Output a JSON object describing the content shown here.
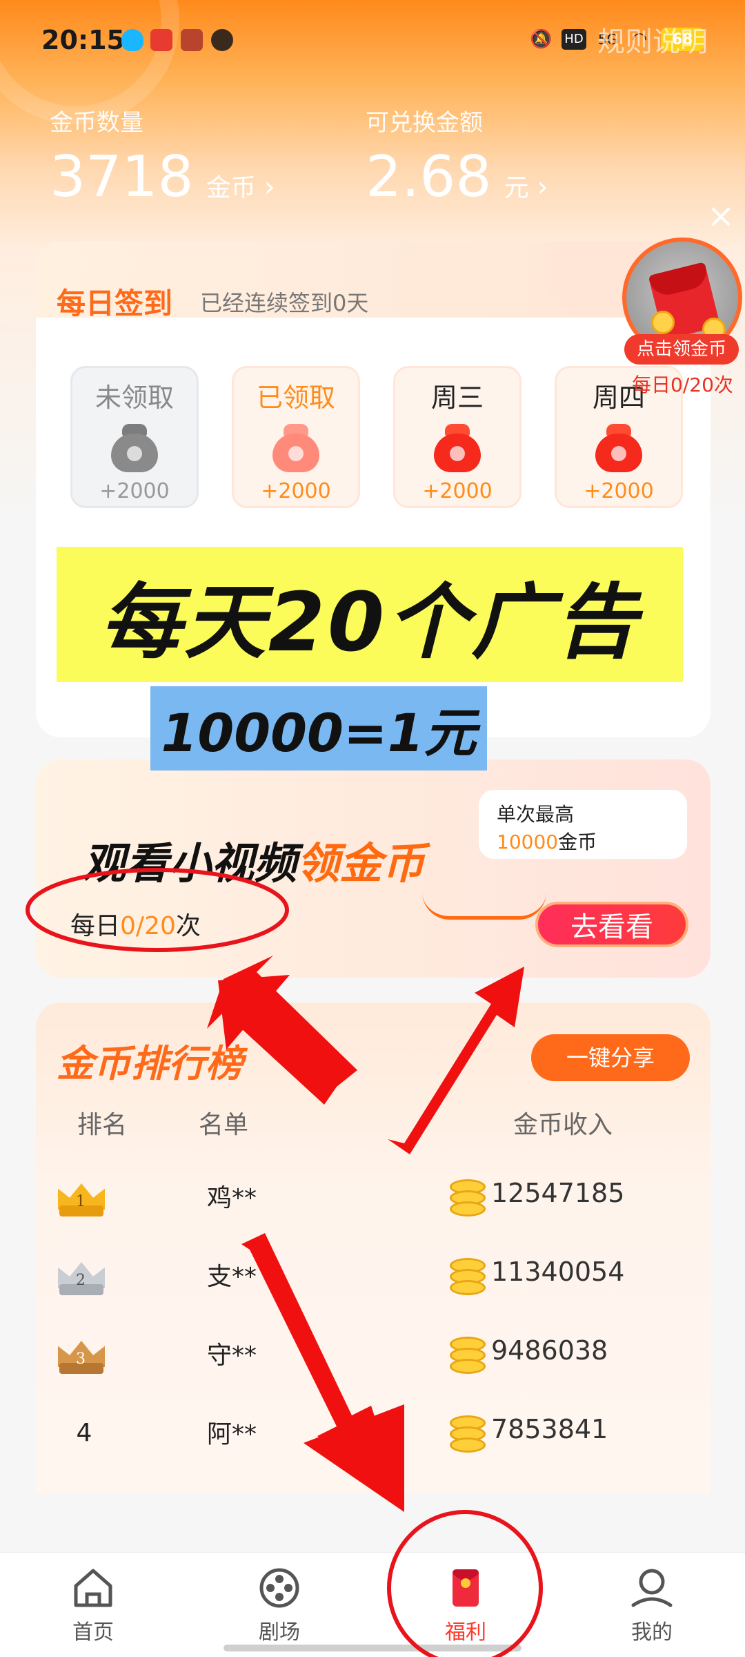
{
  "status_bar": {
    "time": "20:15",
    "battery": "68",
    "network": "5G",
    "hd": "HD"
  },
  "header": {
    "rules_link": "规则说明",
    "coins": {
      "label": "金币数量",
      "value": "3718",
      "unit": "金币",
      "chevron": "›"
    },
    "cash": {
      "label": "可兑换金额",
      "value": "2.68",
      "unit": "元",
      "chevron": "›"
    },
    "close": "×"
  },
  "floating_reward": {
    "button_label": "点击领金币",
    "count_text": "每日0/20次"
  },
  "sign_in": {
    "title": "每日签到",
    "subtitle": "已经连续签到0天",
    "days": [
      {
        "label": "未领取",
        "reward": "+2000",
        "state": "unclaimed"
      },
      {
        "label": "已领取",
        "reward": "+2000",
        "state": "claimed"
      },
      {
        "label": "周三",
        "reward": "+2000",
        "state": "upcoming"
      },
      {
        "label": "周四",
        "reward": "+2000",
        "state": "upcoming"
      }
    ]
  },
  "overlay": {
    "yellow_text": "每天20个广告",
    "blue_text": "10000=1元"
  },
  "video_task": {
    "title_main": "观看小视频",
    "title_highlight": "领金币",
    "bubble_line1": "单次最高",
    "bubble_amount": "10000",
    "bubble_unit": "金币",
    "daily_prefix": "每日",
    "daily_done": "0",
    "daily_slash": "/",
    "daily_total": "20",
    "daily_suffix": "次",
    "button_label": "去看看"
  },
  "leaderboard": {
    "title": "金币排行榜",
    "share_label": "一键分享",
    "headers": {
      "rank": "排名",
      "name": "名单",
      "income": "金币收入"
    },
    "rows": [
      {
        "rank": "1",
        "name": "鸡**",
        "coins": "12547185",
        "medal": "gold"
      },
      {
        "rank": "2",
        "name": "支**",
        "coins": "11340054",
        "medal": "silver"
      },
      {
        "rank": "3",
        "name": "守**",
        "coins": "9486038",
        "medal": "bronze"
      },
      {
        "rank": "4",
        "name": "阿**",
        "coins": "7853841",
        "medal": "none"
      }
    ]
  },
  "bottom_nav": [
    {
      "label": "首页",
      "icon": "home-icon",
      "active": false
    },
    {
      "label": "剧场",
      "icon": "film-reel-icon",
      "active": false
    },
    {
      "label": "福利",
      "icon": "red-packet-icon",
      "active": true
    },
    {
      "label": "我的",
      "icon": "profile-icon",
      "active": false
    }
  ],
  "colors": {
    "brand_orange": "#ff6a1a",
    "accent_red": "#ff3a2b",
    "highlight_yellow": "#fbfc5a",
    "highlight_blue": "#7ab8f2"
  }
}
